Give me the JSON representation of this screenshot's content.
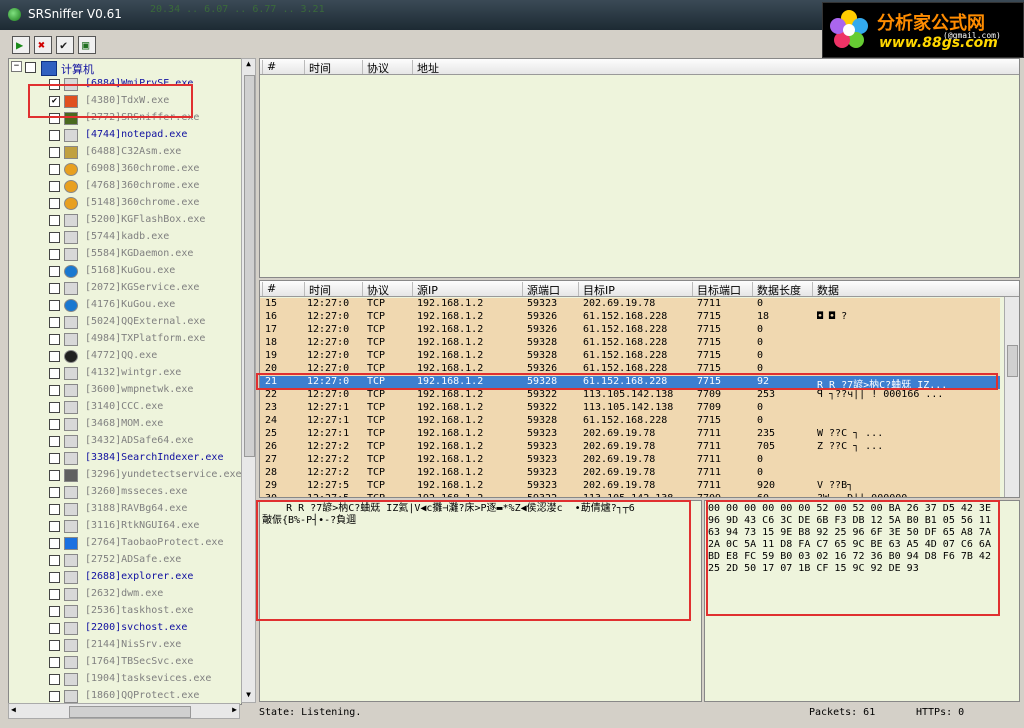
{
  "window": {
    "title": "SRSniffer V0.61",
    "ticker": "  20.34   ..    6.07   ..   6.77   ..   3.21"
  },
  "logo": {
    "brand": "分析家公式网",
    "url": "www.88gs.com",
    "small": "(@gmail.com)"
  },
  "toolbar": [
    {
      "name": "start-icon",
      "glyph": "▶",
      "color": "#1a8a1a"
    },
    {
      "name": "stop-icon",
      "glyph": "✖",
      "color": "#d00000"
    },
    {
      "name": "check-icon",
      "glyph": "✔",
      "color": "#202020"
    },
    {
      "name": "save-icon",
      "glyph": "▣",
      "color": "#207020"
    }
  ],
  "tree": {
    "root_label": "计算机",
    "items": [
      {
        "label": "[6884]WmiPrvSE.exe",
        "checked": false,
        "active": true,
        "icon": "exe"
      },
      {
        "label": "[4380]TdxW.exe",
        "checked": true,
        "active": false,
        "icon": "tdx"
      },
      {
        "label": "[2772]SRSniffer.exe",
        "checked": false,
        "active": false,
        "icon": "srs"
      },
      {
        "label": "[4744]notepad.exe",
        "checked": false,
        "active": true,
        "icon": "exe"
      },
      {
        "label": "[6488]C32Asm.exe",
        "checked": false,
        "active": false,
        "icon": "asm"
      },
      {
        "label": "[6908]360chrome.exe",
        "checked": false,
        "active": false,
        "icon": "chrome"
      },
      {
        "label": "[4768]360chrome.exe",
        "checked": false,
        "active": false,
        "icon": "chrome"
      },
      {
        "label": "[5148]360chrome.exe",
        "checked": false,
        "active": false,
        "icon": "chrome"
      },
      {
        "label": "[5200]KGFlashBox.exe",
        "checked": false,
        "active": false,
        "icon": "exe"
      },
      {
        "label": "[5744]kadb.exe",
        "checked": false,
        "active": false,
        "icon": "exe"
      },
      {
        "label": "[5584]KGDaemon.exe",
        "checked": false,
        "active": false,
        "icon": "exe"
      },
      {
        "label": "[5168]KuGou.exe",
        "checked": false,
        "active": false,
        "icon": "kugou"
      },
      {
        "label": "[2072]KGService.exe",
        "checked": false,
        "active": false,
        "icon": "exe"
      },
      {
        "label": "[4176]KuGou.exe",
        "checked": false,
        "active": false,
        "icon": "kugou"
      },
      {
        "label": "[5024]QQExternal.exe",
        "checked": false,
        "active": false,
        "icon": "exe"
      },
      {
        "label": "[4984]TXPlatform.exe",
        "checked": false,
        "active": false,
        "icon": "exe"
      },
      {
        "label": "[4772]QQ.exe",
        "checked": false,
        "active": false,
        "icon": "qq"
      },
      {
        "label": "[4132]wintgr.exe",
        "checked": false,
        "active": false,
        "icon": "exe"
      },
      {
        "label": "[3600]wmpnetwk.exe",
        "checked": false,
        "active": false,
        "icon": "exe"
      },
      {
        "label": "[3140]CCC.exe",
        "checked": false,
        "active": false,
        "icon": "exe"
      },
      {
        "label": "[3468]MOM.exe",
        "checked": false,
        "active": false,
        "icon": "exe"
      },
      {
        "label": "[3432]ADSafe64.exe",
        "checked": false,
        "active": false,
        "icon": "exe"
      },
      {
        "label": "[3384]SearchIndexer.exe",
        "checked": false,
        "active": true,
        "icon": "exe"
      },
      {
        "label": "[3296]yundetectservice.exe",
        "checked": false,
        "active": false,
        "icon": "gift"
      },
      {
        "label": "[3260]msseces.exe",
        "checked": false,
        "active": false,
        "icon": "exe"
      },
      {
        "label": "[3188]RAVBg64.exe",
        "checked": false,
        "active": false,
        "icon": "exe"
      },
      {
        "label": "[3116]RtkNGUI64.exe",
        "checked": false,
        "active": false,
        "icon": "exe"
      },
      {
        "label": "[2764]TaobaoProtect.exe",
        "checked": false,
        "active": false,
        "icon": "taobao"
      },
      {
        "label": "[2752]ADSafe.exe",
        "checked": false,
        "active": false,
        "icon": "exe"
      },
      {
        "label": "[2688]explorer.exe",
        "checked": false,
        "active": true,
        "icon": "exe"
      },
      {
        "label": "[2632]dwm.exe",
        "checked": false,
        "active": false,
        "icon": "exe"
      },
      {
        "label": "[2536]taskhost.exe",
        "checked": false,
        "active": false,
        "icon": "exe"
      },
      {
        "label": "[2200]svchost.exe",
        "checked": false,
        "active": true,
        "icon": "exe"
      },
      {
        "label": "[2144]NisSrv.exe",
        "checked": false,
        "active": false,
        "icon": "exe"
      },
      {
        "label": "[1764]TBSecSvc.exe",
        "checked": false,
        "active": false,
        "icon": "exe"
      },
      {
        "label": "[1904]tasksevices.exe",
        "checked": false,
        "active": false,
        "icon": "exe"
      },
      {
        "label": "[1860]QQProtect.exe",
        "checked": false,
        "active": false,
        "icon": "exe"
      }
    ]
  },
  "top_table": {
    "headers": [
      "#",
      "时间",
      "协议",
      "地址"
    ]
  },
  "packet_table": {
    "headers": [
      "#",
      "时间",
      "协议",
      "源IP",
      "源端口",
      "目标IP",
      "目标端口",
      "数据长度",
      "数据"
    ],
    "rows": [
      [
        "15",
        "12:27:0",
        "TCP",
        "192.168.1.2",
        "59323",
        "202.69.19.78",
        "7711",
        "0",
        ""
      ],
      [
        "16",
        "12:27:0",
        "TCP",
        "192.168.1.2",
        "59326",
        "61.152.168.228",
        "7715",
        "18",
        "   ◘ ◘ ?"
      ],
      [
        "17",
        "12:27:0",
        "TCP",
        "192.168.1.2",
        "59326",
        "61.152.168.228",
        "7715",
        "0",
        ""
      ],
      [
        "18",
        "12:27:0",
        "TCP",
        "192.168.1.2",
        "59328",
        "61.152.168.228",
        "7715",
        "0",
        ""
      ],
      [
        "19",
        "12:27:0",
        "TCP",
        "192.168.1.2",
        "59328",
        "61.152.168.228",
        "7715",
        "0",
        ""
      ],
      [
        "20",
        "12:27:0",
        "TCP",
        "192.168.1.2",
        "59326",
        "61.152.168.228",
        "7715",
        "0",
        ""
      ],
      [
        "21",
        "12:27:0",
        "TCP",
        "192.168.1.2",
        "59328",
        "61.152.168.228",
        "7715",
        "92",
        "    R R ?7諺>枘C?蛐兓 IZ..."
      ],
      [
        "22",
        "12:27:0",
        "TCP",
        "192.168.1.2",
        "59322",
        "113.105.142.138",
        "7709",
        "253",
        "ꟼ ┐??ч|| !  000166 ..."
      ],
      [
        "23",
        "12:27:1",
        "TCP",
        "192.168.1.2",
        "59322",
        "113.105.142.138",
        "7709",
        "0",
        ""
      ],
      [
        "24",
        "12:27:1",
        "TCP",
        "192.168.1.2",
        "59328",
        "61.152.168.228",
        "7715",
        "0",
        ""
      ],
      [
        "25",
        "12:27:1",
        "TCP",
        "192.168.1.2",
        "59323",
        "202.69.19.78",
        "7711",
        "235",
        "  W  ??C  ┐         ..."
      ],
      [
        "26",
        "12:27:2",
        "TCP",
        "192.168.1.2",
        "59323",
        "202.69.19.78",
        "7711",
        "705",
        "  Z  ??C  ┐         ..."
      ],
      [
        "27",
        "12:27:2",
        "TCP",
        "192.168.1.2",
        "59323",
        "202.69.19.78",
        "7711",
        "0",
        ""
      ],
      [
        "28",
        "12:27:2",
        "TCP",
        "192.168.1.2",
        "59323",
        "202.69.19.78",
        "7711",
        "0",
        ""
      ],
      [
        "29",
        "12:27:5",
        "TCP",
        "192.168.1.2",
        "59323",
        "202.69.19.78",
        "7711",
        "920",
        "  V  ??B┐"
      ],
      [
        "30",
        "12:27:5",
        "TCP",
        "192.168.1.2",
        "59322",
        "113.105.142.138",
        "7709",
        "60",
        "?W  ┐   D||  000000 ..."
      ]
    ],
    "selected_index": 6
  },
  "text_view": "    R R ?7諺>枘C?蛐兓 IZ氦|V◀c攤⊣灘?床>P逐▬*%Z◀侯涊漤c  •莇倩爐?┐┬6\n皾侲{B%-P┤•-?負逥",
  "hex_view": "00 00 00 00 00 00 52 00 52 00 BA 26 37 D5 42 3E\n96 9D 43 C6 3C DE 6B F3 DB 12 5A B0 B1 05 56 11\n63 94 73 15 9E B8 92 25 96 6F 3E 50 DF 65 A8 7A\n2A 0C 5A 11 D8 FA C7 65 9C BE 63 A5 4D 07 C6 6A\nBD E8 FC 59 B0 03 02 16 72 36 B0 94 D8 F6 7B 42\n25 2D 50 17 07 1B CF 15 9C 92 DE 93",
  "status": {
    "state": "State: Listening.",
    "packets": "Packets: 61",
    "https": "HTTPs: 0"
  },
  "colors": {
    "pane_bg": "#eef4dc",
    "row_bg": "#f0d8b0",
    "selected_bg": "#3d7fd0",
    "highlight": "#e03030",
    "active_text": "#1010a0",
    "inactive_text": "#808080"
  }
}
